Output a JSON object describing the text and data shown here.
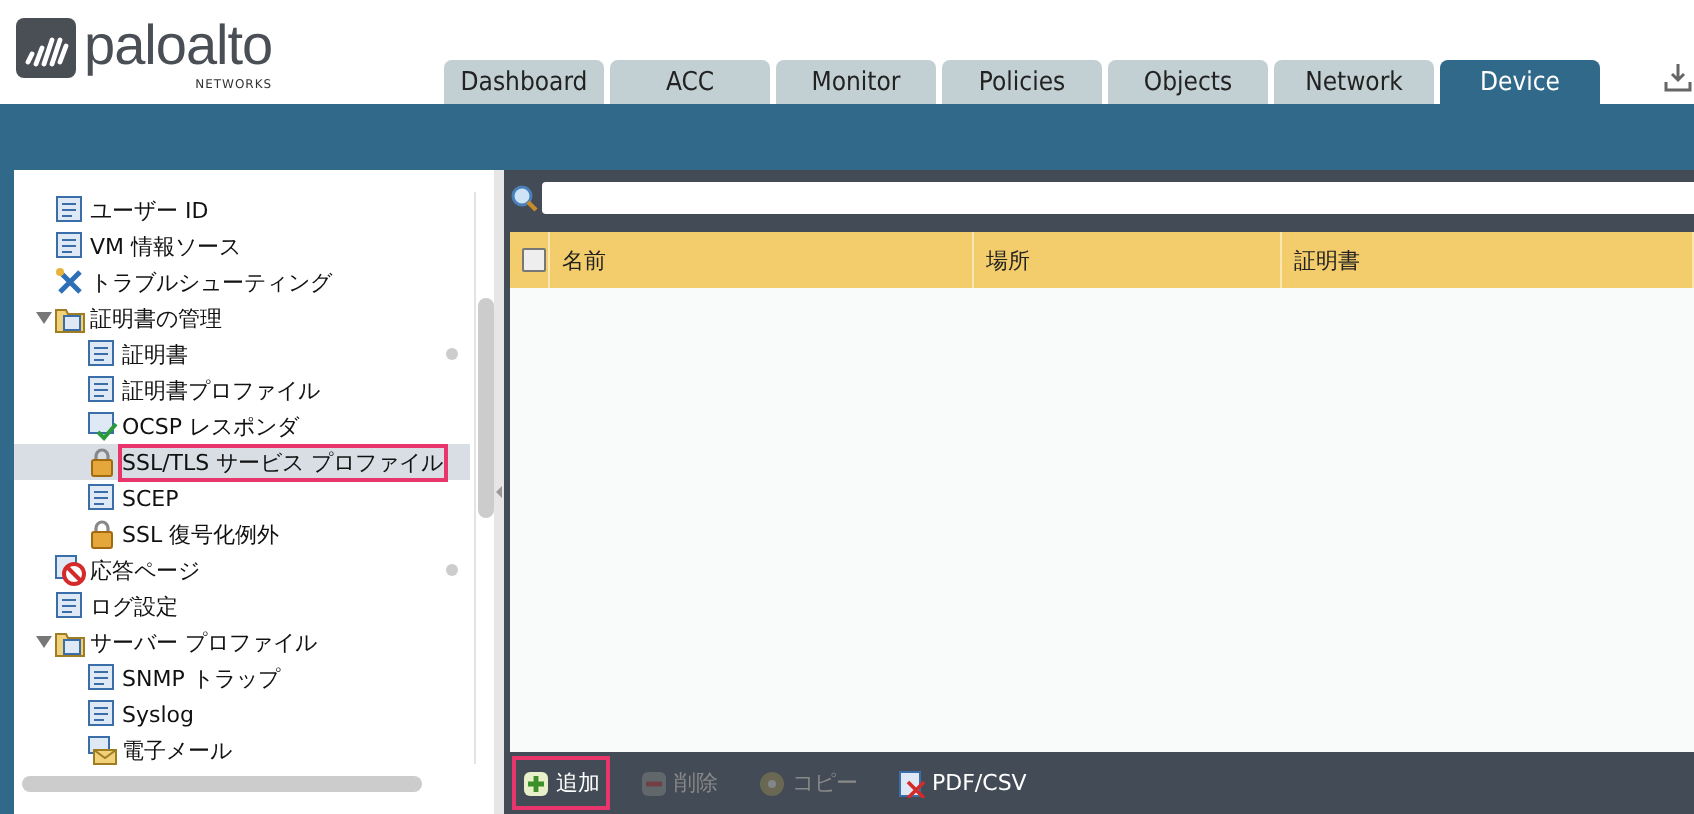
{
  "tabs": [
    {
      "label": "Dashboard",
      "selected": false
    },
    {
      "label": "ACC",
      "selected": false
    },
    {
      "label": "Monitor",
      "selected": false
    },
    {
      "label": "Policies",
      "selected": false
    },
    {
      "label": "Objects",
      "selected": false
    },
    {
      "label": "Network",
      "selected": false
    },
    {
      "label": "Device",
      "selected": true
    }
  ],
  "logo": {
    "name": "paloalto",
    "sub": "NETWORKS"
  },
  "tree": [
    {
      "label": "ユーザー ID",
      "selected": false,
      "highlighted": false,
      "indicator": false
    },
    {
      "label": "VM 情報ソース",
      "selected": false,
      "highlighted": false,
      "indicator": false
    },
    {
      "label": "トラブルシューティング",
      "selected": false,
      "highlighted": false,
      "indicator": false
    },
    {
      "label": "証明書の管理",
      "selected": false,
      "highlighted": false,
      "indicator": false,
      "expanded": true,
      "children": [
        {
          "label": "証明書",
          "selected": false,
          "highlighted": false,
          "indicator": true
        },
        {
          "label": "証明書プロファイル",
          "selected": false,
          "highlighted": false,
          "indicator": false
        },
        {
          "label": "OCSP レスポンダ",
          "selected": false,
          "highlighted": false,
          "indicator": false
        },
        {
          "label": "SSL/TLS サービス プロファイル",
          "selected": true,
          "highlighted": true,
          "indicator": false
        },
        {
          "label": "SCEP",
          "selected": false,
          "highlighted": false,
          "indicator": false
        },
        {
          "label": "SSL 復号化例外",
          "selected": false,
          "highlighted": false,
          "indicator": false
        }
      ]
    },
    {
      "label": "応答ページ",
      "selected": false,
      "highlighted": false,
      "indicator": true
    },
    {
      "label": "ログ設定",
      "selected": false,
      "highlighted": false,
      "indicator": false
    },
    {
      "label": "サーバー プロファイル",
      "selected": false,
      "highlighted": false,
      "indicator": false,
      "expanded": true,
      "children": [
        {
          "label": "SNMP トラップ",
          "selected": false,
          "highlighted": false,
          "indicator": false
        },
        {
          "label": "Syslog",
          "selected": false,
          "highlighted": false,
          "indicator": false
        },
        {
          "label": "電子メール",
          "selected": false,
          "highlighted": false,
          "indicator": false
        }
      ]
    }
  ],
  "table": {
    "select_all": {
      "checked": false
    },
    "columns": [
      "名前",
      "場所",
      "証明書"
    ]
  },
  "toolbar": [
    {
      "label": "追加",
      "disabled": false,
      "highlighted": true
    },
    {
      "label": "削除",
      "disabled": true,
      "highlighted": false
    },
    {
      "label": "コピー",
      "disabled": true,
      "highlighted": false
    },
    {
      "label": "PDF/CSV",
      "disabled": false,
      "highlighted": false
    }
  ]
}
